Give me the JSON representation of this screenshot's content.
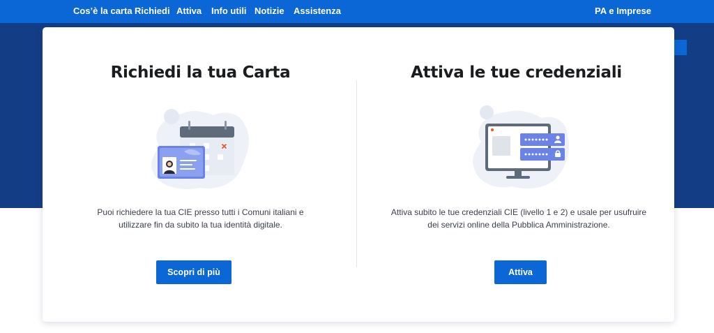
{
  "nav": {
    "items": [
      {
        "label": "Cos’è la carta"
      },
      {
        "label": "Richiedi"
      },
      {
        "label": "Attiva"
      },
      {
        "label": "Info utili"
      },
      {
        "label": "Notizie"
      },
      {
        "label": "Assistenza"
      }
    ],
    "right_label": "PA e Imprese"
  },
  "panels": [
    {
      "title": "Richiedi la tua Carta",
      "illustration": "id-card-calendar-icon",
      "text_line1": "Puoi richiedere la tua CIE presso tutti i Comuni italiani e",
      "text_line2": "utilizzare fin da subito la tua identità digitale.",
      "button_label": "Scopri di più"
    },
    {
      "title": "Attiva le tue credenziali",
      "illustration": "monitor-credentials-icon",
      "text_line1": "Attiva subito le tue credenziali CIE (livello 1 e 2) e usale per usufruire",
      "text_line2": "dei servizi online della Pubblica Amministrazione.",
      "button_label": "Attiva"
    }
  ],
  "colors": {
    "nav_bg": "#0b66d6",
    "hero_bg": "#133e86",
    "button_bg": "#0b66d6",
    "illustration_accent": "#6b83e6",
    "illustration_blob": "#eef1f8"
  }
}
